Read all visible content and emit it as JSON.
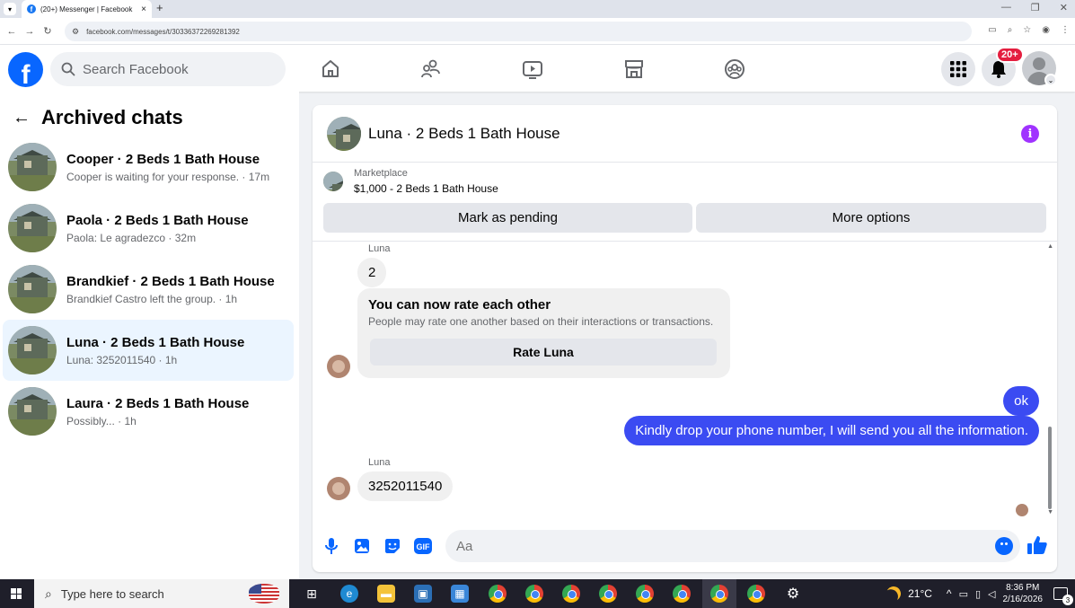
{
  "browser": {
    "tab_title": "(20+) Messenger | Facebook",
    "tab_close": "×",
    "new_tab": "+",
    "url": "facebook.com/messages/t/30336372269281392"
  },
  "header": {
    "search_placeholder": "Search Facebook",
    "notification_count": "20+"
  },
  "sidebar": {
    "title": "Archived chats",
    "chats": [
      {
        "name": "Cooper · 2 Beds 1 Bath House",
        "preview": "Cooper is waiting for your response. · 17m"
      },
      {
        "name": "Paola · 2 Beds 1 Bath House",
        "preview": "Paola: Le agradezco · 32m"
      },
      {
        "name": "Brandkief · 2 Beds 1 Bath House",
        "preview": "Brandkief Castro left the group. · 1h"
      },
      {
        "name": "Luna · 2 Beds 1 Bath House",
        "preview": "Luna: 3252011540 · 1h",
        "active": true
      },
      {
        "name": "Laura · 2 Beds 1 Bath House",
        "preview": "Possibly... · 1h"
      }
    ]
  },
  "conversation": {
    "title": "Luna · 2 Beds 1 Bath House",
    "marketplace_label": "Marketplace",
    "marketplace_item": "$1,000 - 2 Beds 1 Bath House",
    "mark_pending_label": "Mark as pending",
    "more_options_label": "More options",
    "messages": {
      "sender_1": "Luna",
      "msg_1": "2",
      "rate_title": "You can now rate each other",
      "rate_subtitle": "People may rate one another based on their interactions or transactions.",
      "rate_button": "Rate Luna",
      "out_1": "ok",
      "out_2": "Kindly drop your phone number, I will send you all the information.",
      "sender_2": "Luna",
      "msg_2": "3252011540"
    },
    "composer_placeholder": "Aa"
  },
  "taskbar": {
    "search_placeholder": "Type here to search",
    "temperature": "21°C",
    "time": "8:36 PM",
    "date": "2/16/2026",
    "notification_count": "3"
  },
  "colors": {
    "fb_blue": "#0866ff",
    "outgoing_bubble": "#3b4bf2",
    "active_chat_bg": "#ebf5ff",
    "info_purple": "#a033ff",
    "notification_red": "#e41e3f"
  }
}
